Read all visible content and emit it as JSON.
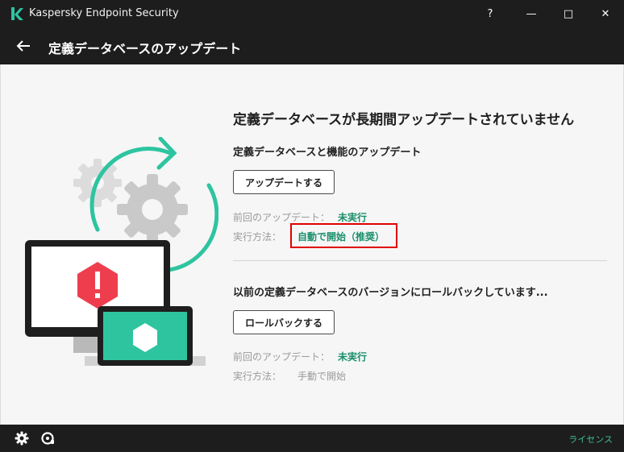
{
  "window": {
    "title": "Kaspersky Endpoint Security",
    "help_label": "?",
    "minimize_label": "—",
    "maximize_label": "□",
    "close_label": "✕"
  },
  "header": {
    "title": "定義データベースのアップデート"
  },
  "main": {
    "headline": "定義データベースが長期間アップデートされていません",
    "update_section": {
      "title": "定義データベースと機能のアップデート",
      "button_label": "アップデートする",
      "last_update_label": "前回のアップデート：",
      "last_update_value": "未実行",
      "run_mode_label": "実行方法：",
      "run_mode_value": "自動で開始（推奨）"
    },
    "rollback_section": {
      "title": "以前の定義データベースのバージョンにロールバックしています...",
      "button_label": "ロールバックする",
      "last_update_label": "前回のアップデート：",
      "last_update_value": "未実行",
      "run_mode_label": "実行方法：",
      "run_mode_value": "手動で開始"
    }
  },
  "footer": {
    "license_label": "ライセンス"
  },
  "icons": {
    "logo": "kaspersky-k-icon",
    "back": "arrow-left-icon",
    "settings": "gear-icon",
    "support": "support-icon",
    "alert": "exclamation-hexagon-icon"
  },
  "colors": {
    "accent_green": "#1a8f6b",
    "teal": "#2ec4a0",
    "alert_red": "#ee3e4e",
    "highlight_red": "#e00000",
    "dark_chrome": "#1d1d1d"
  }
}
